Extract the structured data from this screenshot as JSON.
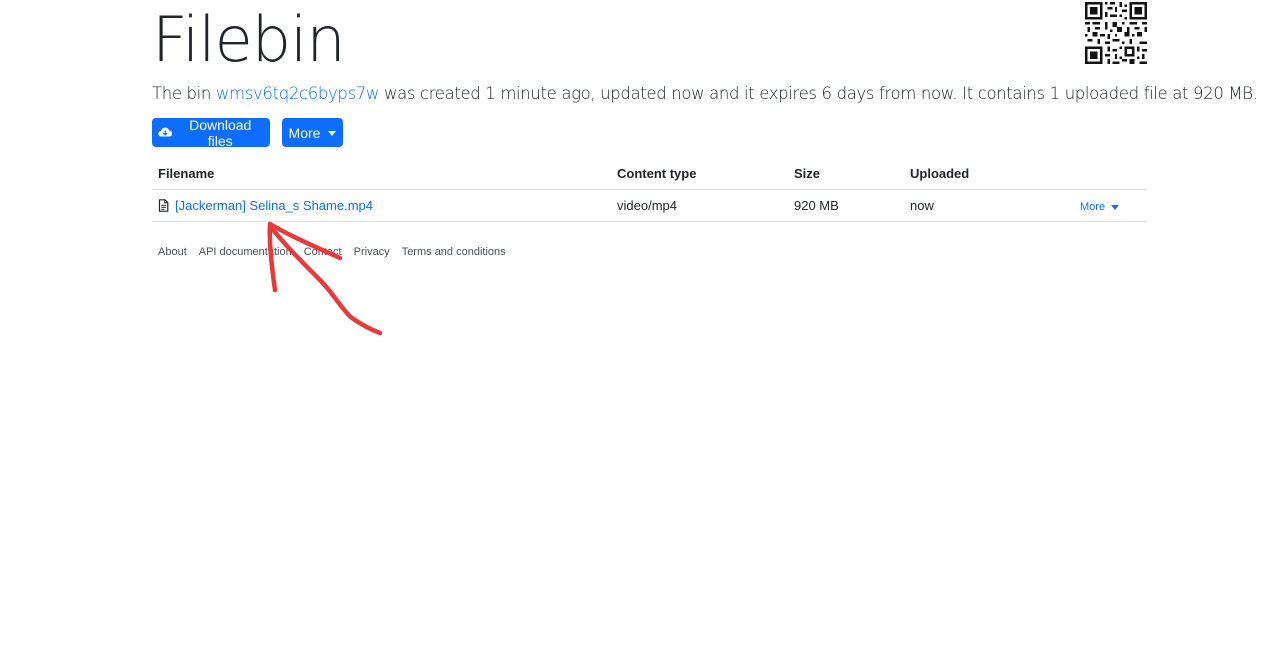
{
  "header": {
    "title": "Filebin"
  },
  "summary": {
    "prefix": "The bin ",
    "bin_id": "wmsv6tq2c6byps7w",
    "suffix": " was created 1 minute ago, updated now and it expires 6 days from now. It contains 1 uploaded file at 920 MB."
  },
  "actions": {
    "download_label": "Download files",
    "more_label": "More"
  },
  "table": {
    "columns": [
      "Filename",
      "Content type",
      "Size",
      "Uploaded"
    ],
    "rows": [
      {
        "filename": "[Jackerman] Selina_s Shame.mp4",
        "content_type": "video/mp4",
        "size": "920 MB",
        "uploaded": "now",
        "more_label": "More"
      }
    ]
  },
  "footer": {
    "links": [
      "About",
      "API documentation",
      "Contact",
      "Privacy",
      "Terms and conditions"
    ]
  },
  "colors": {
    "accent": "#0d6efd",
    "annotation": "#e8393b"
  },
  "icons": {
    "download": "cloud-download-icon",
    "file": "file-icon",
    "qr": "qr-code-icon"
  }
}
